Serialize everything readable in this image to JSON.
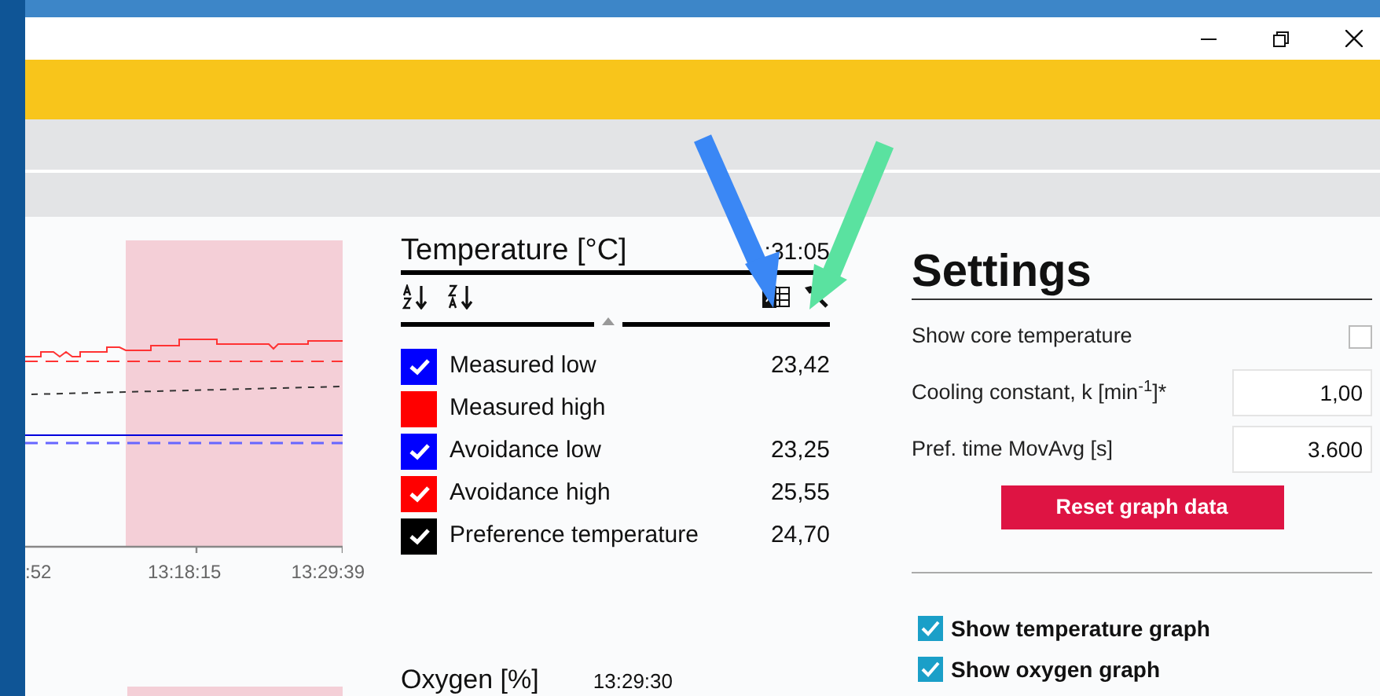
{
  "temperature_chart": {
    "x_ticks": [
      ":52",
      "13:18:15",
      "13:29:39"
    ]
  },
  "temperature_legend": {
    "title": "Temperature [°C]",
    "time": ":31:05",
    "items": [
      {
        "label": "Measured low",
        "value": "23,42",
        "color": "#0000ff",
        "checked": true
      },
      {
        "label": "Measured high",
        "color": "#ff0000",
        "checked": false
      },
      {
        "label": "Avoidance low",
        "value": "23,25",
        "color": "#0000ff",
        "checked": true
      },
      {
        "label": "Avoidance high",
        "value": "25,55",
        "color": "#ff0000",
        "checked": true
      },
      {
        "label": "Preference temperature",
        "value": "24,70",
        "color": "#000000",
        "checked": true
      }
    ]
  },
  "settings": {
    "title": "Settings",
    "rows": [
      {
        "kind": "checkbox",
        "label": "Show core temperature",
        "checked": false
      },
      {
        "kind": "field",
        "label": "Cooling constant, k [min$^{-1}$]*",
        "value": "1,00"
      },
      {
        "kind": "field",
        "label": "Pref. time MovAvg [s]",
        "value": "3.600"
      }
    ],
    "reset_button": "Reset graph data",
    "graph_toggles": [
      {
        "label": "Show temperature graph",
        "checked": true
      },
      {
        "label": "Show oxygen graph",
        "checked": true
      }
    ]
  },
  "oxygen_legend": {
    "title": "Oxygen [%]",
    "time": "13:29:30"
  },
  "annotations": [
    {
      "color": "#3a87f5"
    },
    {
      "color": "#5ae2a0"
    }
  ]
}
